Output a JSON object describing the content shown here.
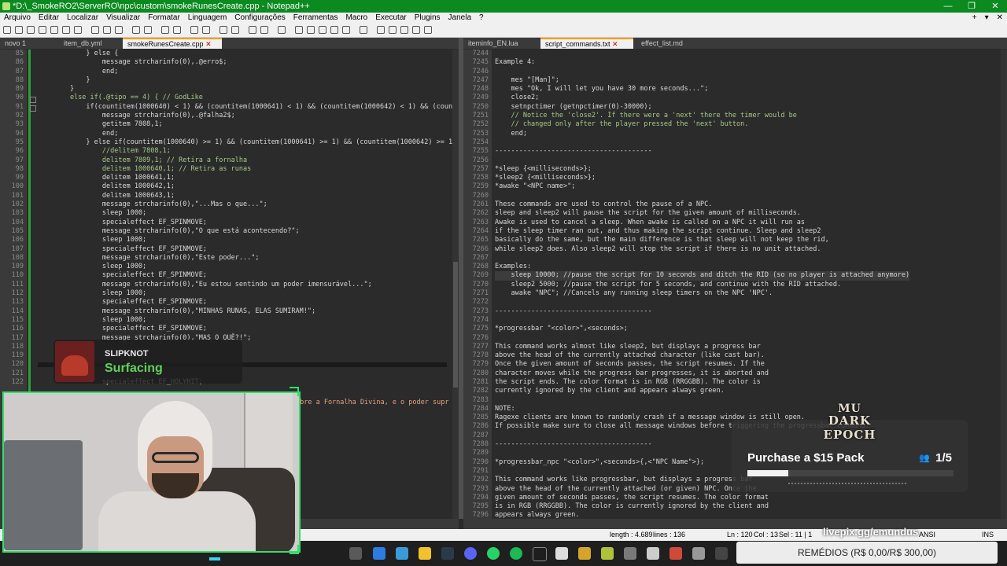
{
  "window": {
    "title": "*D:\\_SmokeRO2\\ServerRO\\npc\\custom\\smokeRunesCreate.cpp - Notepad++",
    "controls": [
      "—",
      "❐",
      "✕"
    ]
  },
  "menu": {
    "items": [
      "Arquivo",
      "Editar",
      "Localizar",
      "Visualizar",
      "Formatar",
      "Linguagem",
      "Configurações",
      "Ferramentas",
      "Macro",
      "Executar",
      "Plugins",
      "Janela",
      "?"
    ],
    "right": [
      "+",
      "▾",
      "✕"
    ]
  },
  "left_tabs": [
    {
      "label": "novo 1",
      "active": false
    },
    {
      "label": "item_db.yml",
      "active": false
    },
    {
      "label": "smokeRunesCreate.cpp",
      "active": true
    }
  ],
  "right_tabs": [
    {
      "label": "iteminfo_EN.lua",
      "active": false
    },
    {
      "label": "script_commands.txt",
      "active": true
    },
    {
      "label": "effect_list.md",
      "active": false
    }
  ],
  "left_editor": {
    "line_numbers": [
      "85",
      "86",
      "87",
      "88",
      "89",
      "90",
      "91",
      "92",
      "93",
      "94",
      "95",
      "96",
      "97",
      "98",
      "99",
      "100",
      "101",
      "102",
      "103",
      "104",
      "105",
      "106",
      "107",
      "108",
      "109",
      "110",
      "111",
      "112",
      "113",
      "114",
      "115",
      "116",
      "117",
      "118",
      "119",
      "120",
      "121",
      "122"
    ],
    "lines": [
      "            } else {",
      "                message strcharinfo(0),.@erro$;",
      "                end;",
      "            }",
      "        }",
      "        else if(.@tipo == 4) { // GodLike",
      "            if(countitem(1000640) < 1) && (countitem(1000641) < 1) && (countitem(1000642) < 1) && (countitem(10",
      "                message strcharinfo(0),.@falha2$;",
      "                getitem 7808,1;",
      "                end;",
      "            } else if(countitem(1000640) >= 1) && (countitem(1000641) >= 1) && (countitem(1000642) >= 1) && (co",
      "                //delitem 7808,1;",
      "                delitem 7809,1; // Retira a fornalha",
      "                delitem 1000640,1; // Retira as runas",
      "                delitem 1000641,1;",
      "                delitem 1000642,1;",
      "                delitem 1000643,1;",
      "                message strcharinfo(0),\"...Mas o que...\";",
      "                sleep 1000;",
      "                specialeffect EF_SPINMOVE;",
      "                message strcharinfo(0),\"O que está acontecendo?\";",
      "                sleep 1000;",
      "                specialeffect EF_SPINMOVE;",
      "                message strcharinfo(0),\"Este poder...\";",
      "                sleep 1000;",
      "                specialeffect EF_SPINMOVE;",
      "                message strcharinfo(0),\"Eu estou sentindo um poder imensurável...\";",
      "                sleep 1000;",
      "                specialeffect EF_SPINMOVE;",
      "                message strcharinfo(0),\"MINHAS RUNAS, ELAS SUMIRAM!\";",
      "                sleep 1000;",
      "                specialeffect EF_SPINMOVE;",
      "                message strcharinfo(0),\"MAS O QUÊ?!\";",
      "",
      "",
      "",
      "",
      "                specialeffect EF_HOLYHIT;"
    ],
    "overflow_text": "obre a Fornalha Divina, e o poder supr"
  },
  "right_editor": {
    "line_numbers": [
      "7244",
      "7245",
      "7246",
      "7247",
      "7248",
      "7249",
      "7250",
      "7251",
      "7252",
      "7253",
      "7254",
      "7255",
      "7256",
      "7257",
      "7258",
      "7259",
      "7260",
      "7261",
      "7262",
      "7263",
      "7264",
      "7265",
      "7266",
      "7267",
      "7268",
      "7269",
      "7270",
      "7271",
      "7272",
      "7273",
      "7274",
      "7275",
      "7276",
      "7277",
      "7278",
      "7279",
      "7280",
      "7281",
      "7282",
      "7283",
      "7284",
      "7285",
      "7286",
      "7287",
      "7288",
      "7289",
      "7290",
      "7291",
      "7292",
      "7293",
      "7294",
      "7295",
      "7296"
    ],
    "lines": [
      "",
      "Example 4:",
      "",
      "    mes \"[Man]\";",
      "    mes \"Ok, I will let you have 30 more seconds...\";",
      "    close2;",
      "    setnpctimer (getnpctimer(0)-30000);",
      "    // Notice the 'close2'. If there were a 'next' there the timer would be",
      "    // changed only after the player pressed the 'next' button.",
      "    end;",
      "",
      "---------------------------------------",
      "",
      "*sleep {<milliseconds>};",
      "*sleep2 {<milliseconds>};",
      "*awake \"<NPC name>\";",
      "",
      "These commands are used to control the pause of a NPC.",
      "sleep and sleep2 will pause the script for the given amount of milliseconds.",
      "Awake is used to cancel a sleep. When awake is called on a NPC it will run as",
      "if the sleep timer ran out, and thus making the script continue. Sleep and sleep2",
      "basically do the same, but the main difference is that sleep will not keep the rid,",
      "while sleep2 does. Also sleep2 will stop the script if there is no unit attached.",
      "",
      "Examples:",
      "    sleep 10000; //pause the script for 10 seconds and ditch the RID (so no player is attached anymore)",
      "    sleep2 5000; //pause the script for 5 seconds, and continue with the RID attached.",
      "    awake \"NPC\"; //Cancels any running sleep timers on the NPC 'NPC'.",
      "",
      "---------------------------------------",
      "",
      "*progressbar \"<color>\",<seconds>;",
      "",
      "This command works almost like sleep2, but displays a progress bar",
      "above the head of the currently attached character (like cast bar).",
      "Once the given amount of seconds passes, the script resumes. If the",
      "character moves while the progress bar progresses, it is aborted and",
      "the script ends. The color format is in RGB (RRGGBB). The color is",
      "currently ignored by the client and appears always green.",
      "",
      "NOTE:",
      "Ragexe clients are known to randomly crash if a message window is still open.",
      "If possible make sure to close all message windows before triggering the progressbar command.",
      "",
      "---------------------------------------",
      "",
      "*progressbar_npc \"<color>\",<seconds>{,<\"NPC Name\">};",
      "",
      "This command works like progressbar, but displays a progress bar",
      "above the head of the currently attached (or given) NPC. Once the",
      "given amount of seconds passes, the script resumes. The color format",
      "is in RGB (RRGGBB). The color is currently ignored by the client and",
      "appears always green."
    ]
  },
  "status": {
    "length": "length : 4.689",
    "lines": "lines : 136",
    "position": "Ln : 120",
    "col": "Col : 13",
    "sel": "Sel : 11 | 1",
    "encoding": "ANSI",
    "mode": "INS"
  },
  "song_overlay": {
    "artist": "SLIPKNOT",
    "title": "Surfacing"
  },
  "goal_overlay": {
    "title": "Purchase a $15 Pack",
    "count": "1/5",
    "progress": 0.2,
    "logo_line1": "MU",
    "logo_line2": "DARK EPOCH"
  },
  "livepix": "livepix.gg/emundus",
  "donation_goal": "REMÉDIOS (R$ 0,00/R$ 300,00)",
  "colors": {
    "titlebar": "#0b8a1f",
    "accent_green": "#31e06a",
    "song_green": "#5fd35a"
  }
}
